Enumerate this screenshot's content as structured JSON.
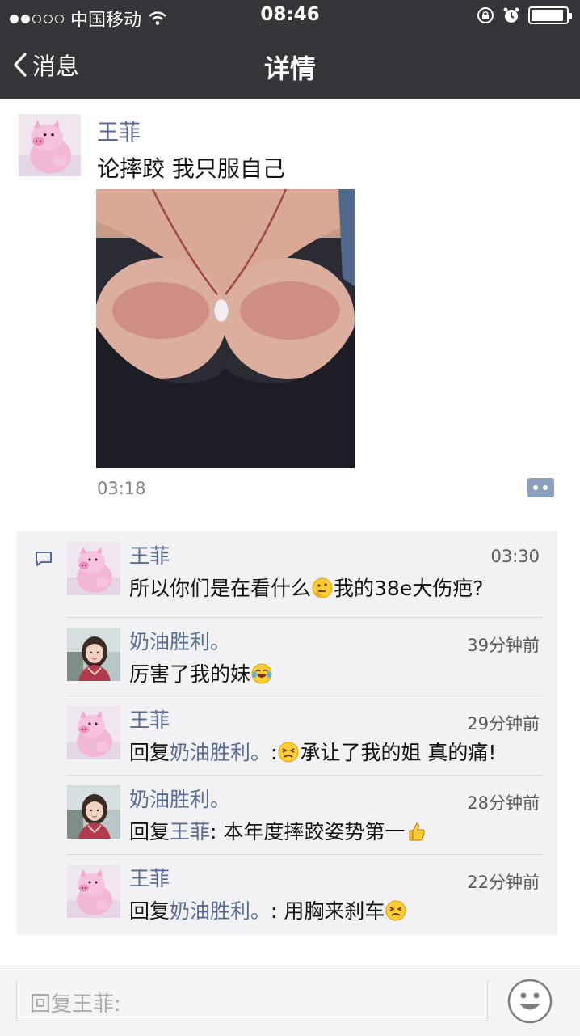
{
  "status_bar": {
    "carrier": "中国移动",
    "time": "08:46",
    "signal_bars_filled": 2,
    "signal_bars_total": 5,
    "battery_level": 0.85
  },
  "nav": {
    "back_label": "消息",
    "title": "详情"
  },
  "post": {
    "author": "王菲",
    "text": "论摔跤 我只服自己",
    "time": "03:18"
  },
  "comments": [
    {
      "name": "王菲",
      "time": "03:30",
      "prefix": "",
      "reply_to": "",
      "before": "所以你们是在看什么",
      "emoji": "thinking-emoji",
      "after": "我的38e大伤疤?"
    },
    {
      "name": "奶油胜利。",
      "time": "39分钟前",
      "prefix": "",
      "reply_to": "",
      "before": "厉害了我的妹",
      "emoji": "laughing-tears-emoji",
      "after": ""
    },
    {
      "name": "王菲",
      "time": "29分钟前",
      "prefix": "回复",
      "reply_to": "奶油胜利。",
      "before": ":",
      "emoji": "persevering-face-emoji",
      "after": "承让了我的姐 真的痛!"
    },
    {
      "name": "奶油胜利。",
      "time": "28分钟前",
      "prefix": "回复",
      "reply_to": "王菲",
      "before": ": 本年度摔跤姿势第一",
      "emoji": "thumbs-up-emoji",
      "after": ""
    },
    {
      "name": "王菲",
      "time": "22分钟前",
      "prefix": "回复",
      "reply_to": "奶油胜利。",
      "before": ": 用胸来刹车",
      "emoji": "persevering-face-emoji",
      "after": ""
    }
  ],
  "input": {
    "placeholder": "回复王菲:"
  },
  "colors": {
    "nav_bg": "#36363a",
    "link": "#576b95",
    "comment_bg": "#f2f2f4"
  }
}
